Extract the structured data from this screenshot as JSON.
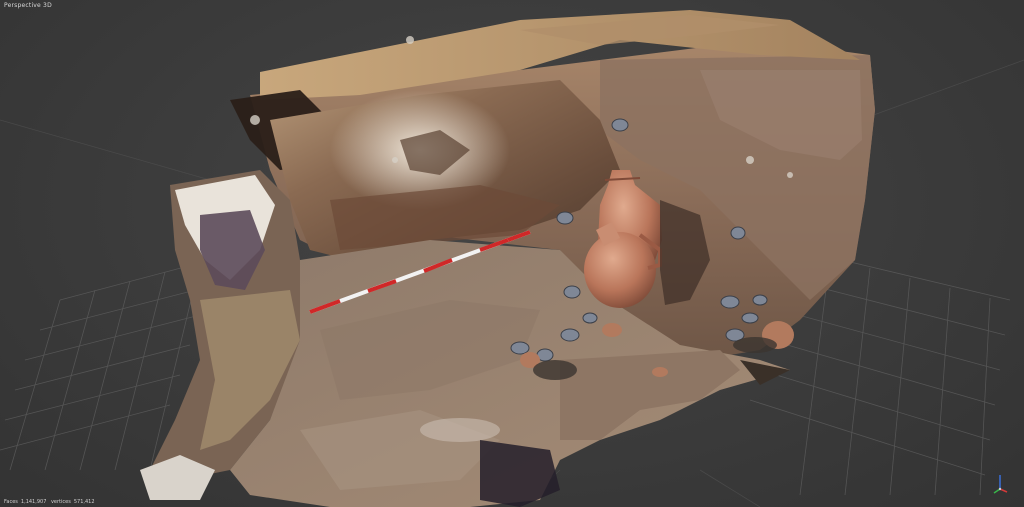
{
  "viewport": {
    "view_label": "Perspective 3D",
    "stats": {
      "faces_label": "Faces",
      "faces_value": "1,141,907",
      "vertices_label": "vertices",
      "vertices_value": "571,412"
    }
  },
  "colors": {
    "background": "#3d3d3d",
    "grid": "#5a5a5a",
    "axis_x": "#d33a3a",
    "axis_y": "#39b54a",
    "axis_z": "#3a6fd8"
  },
  "icons": {
    "axis_gizmo": "xyz-axis-gizmo-icon"
  }
}
